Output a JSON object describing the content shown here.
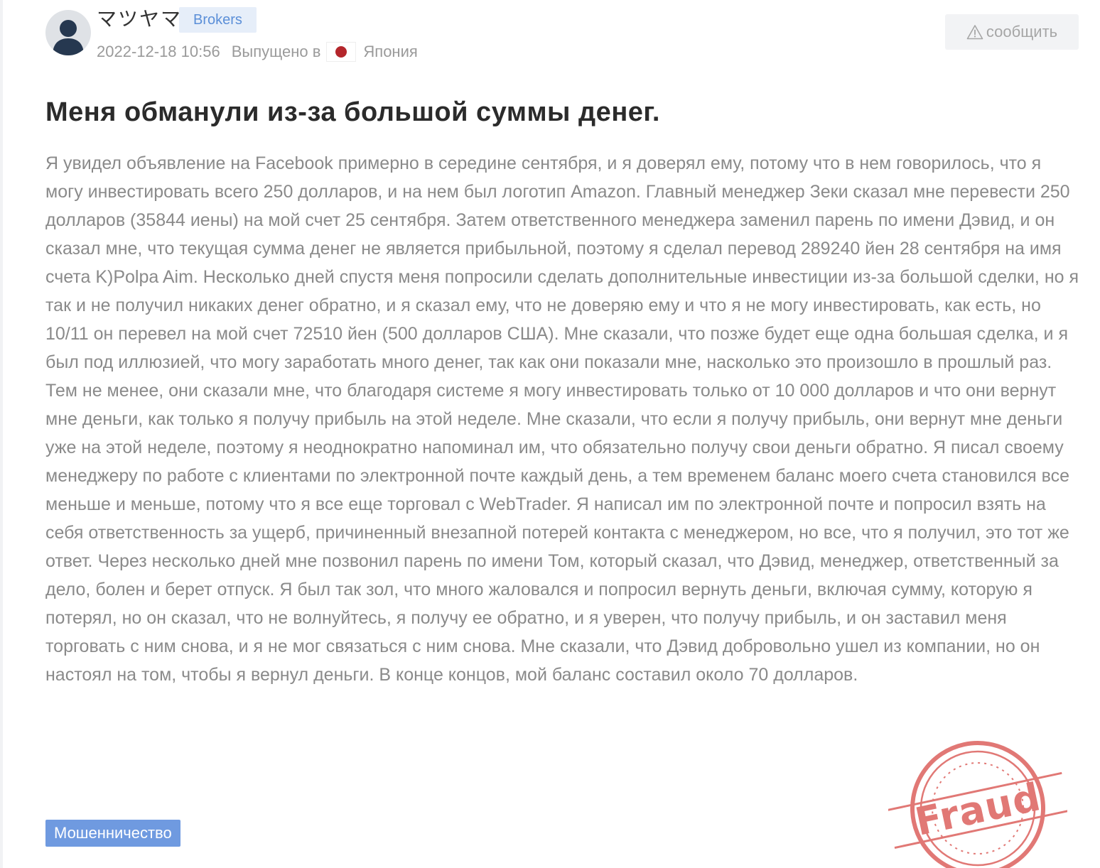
{
  "user": {
    "name": "マツヤマ",
    "badge": "Brokers"
  },
  "meta": {
    "date": "2022-12-18 10:56",
    "issued_in": "Выпущено в",
    "country": "Япония",
    "flag_icon": "japan-flag-icon"
  },
  "report_button": {
    "icon": "warning-icon",
    "label": "сообщить"
  },
  "post": {
    "title": "Меня обманули из-за большой суммы денег.",
    "body": "Я увидел объявление на Facebook примерно в середине сентября, и я доверял ему, потому что в нем говорилось, что я могу инвестировать всего 250 долларов, и на нем был логотип Amazon. Главный менеджер Зеки сказал мне перевести 250 долларов (35844 иены) на мой счет 25 сентября. Затем ответственного менеджера заменил парень по имени Дэвид, и он сказал мне, что текущая сумма денег не является прибыльной, поэтому я сделал перевод 289240 йен 28 сентября на имя счета K)Polpa Aim. Несколько дней спустя меня попросили сделать дополнительные инвестиции из-за большой сделки, но я так и не получил никаких денег обратно, и я сказал ему, что не доверяю ему и что я не могу инвестировать, как есть, но 10/11 он перевел на мой счет 72510 йен (500 долларов США). Мне сказали, что позже будет еще одна большая сделка, и я был под иллюзией, что могу заработать много денег, так как они показали мне, насколько это произошло в прошлый раз. Тем не менее, они сказали мне, что благодаря системе я могу инвестировать только от 10 000 долларов и что они вернут мне деньги, как только я получу прибыль на этой неделе. Мне сказали, что если я получу прибыль, они вернут мне деньги уже на этой неделе, поэтому я неоднократно напоминал им, что обязательно получу свои деньги обратно. Я писал своему менеджеру по работе с клиентами по электронной почте каждый день, а тем временем баланс моего счета становился все меньше и меньше, потому что я все еще торговал с WebTrader. Я написал им по электронной почте и попросил взять на себя ответственность за ущерб, причиненный внезапной потерей контакта с менеджером, но все, что я получил, это тот же ответ. Через несколько дней мне позвонил парень по имени Том, который сказал, что Дэвид, менеджер, ответственный за дело, болен и берет отпуск. Я был так зол, что много жаловался и попросил вернуть деньги, включая сумму, которую я потерял, но он сказал, что не волнуйтесь, я получу ее обратно, и я уверен, что получу прибыль, и он заставил меня торговать с ним снова, и я не мог связаться с ним снова. Мне сказали, что Дэвид добровольно ушел из компании, но он настоял на том, чтобы я вернул деньги. В конце концов, мой баланс составил около 70 долларов.",
    "category": "Мошенничество"
  },
  "stamp": {
    "text": "Fraud",
    "color": "#d9534f"
  },
  "colors": {
    "body_text": "#8a8a8a",
    "title_text": "#2b2b2b",
    "badge_blue": "#5b8fd8",
    "tag_blue": "#6f9ae0",
    "flag_red": "#b4262b"
  }
}
